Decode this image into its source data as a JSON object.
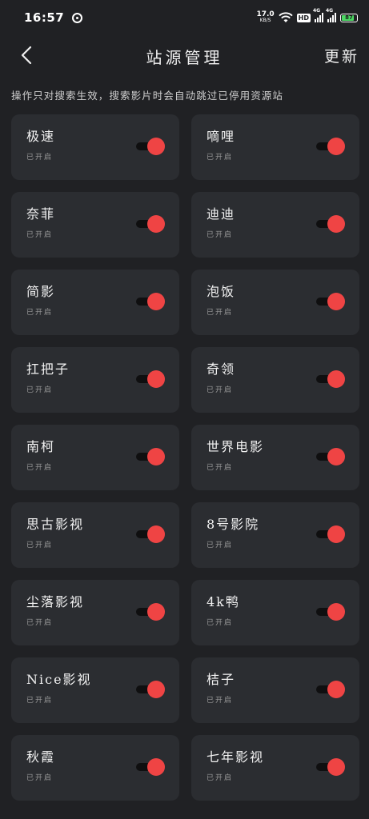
{
  "status_bar": {
    "time": "16:57",
    "net_speed_value": "17.0",
    "net_speed_unit": "KB/S",
    "hd_label": "HD",
    "signal_tag_1": "4G",
    "signal_tag_2": "4G",
    "battery_level": "87",
    "battery_color": "#4cd964"
  },
  "header": {
    "title": "站源管理",
    "update_label": "更新",
    "back_icon": "chevron-left-icon"
  },
  "hint": "操作只对搜索生效，搜索影片时会自动跳过已停用资源站",
  "accent_color": "#ef4444",
  "sources": [
    {
      "name": "极速",
      "status": "已开启",
      "enabled": true
    },
    {
      "name": "嘀哩",
      "status": "已开启",
      "enabled": true
    },
    {
      "name": "奈菲",
      "status": "已开启",
      "enabled": true
    },
    {
      "name": "迪迪",
      "status": "已开启",
      "enabled": true
    },
    {
      "name": "简影",
      "status": "已开启",
      "enabled": true
    },
    {
      "name": "泡饭",
      "status": "已开启",
      "enabled": true
    },
    {
      "name": "扛把子",
      "status": "已开启",
      "enabled": true
    },
    {
      "name": "奇领",
      "status": "已开启",
      "enabled": true
    },
    {
      "name": "南柯",
      "status": "已开启",
      "enabled": true
    },
    {
      "name": "世界电影",
      "status": "已开启",
      "enabled": true
    },
    {
      "name": "思古影视",
      "status": "已开启",
      "enabled": true
    },
    {
      "name": "8号影院",
      "status": "已开启",
      "enabled": true
    },
    {
      "name": "尘落影视",
      "status": "已开启",
      "enabled": true
    },
    {
      "name": "4k鸭",
      "status": "已开启",
      "enabled": true
    },
    {
      "name": "Nice影视",
      "status": "已开启",
      "enabled": true
    },
    {
      "name": "桔子",
      "status": "已开启",
      "enabled": true
    },
    {
      "name": "秋霞",
      "status": "已开启",
      "enabled": true
    },
    {
      "name": "七年影视",
      "status": "已开启",
      "enabled": true
    }
  ]
}
